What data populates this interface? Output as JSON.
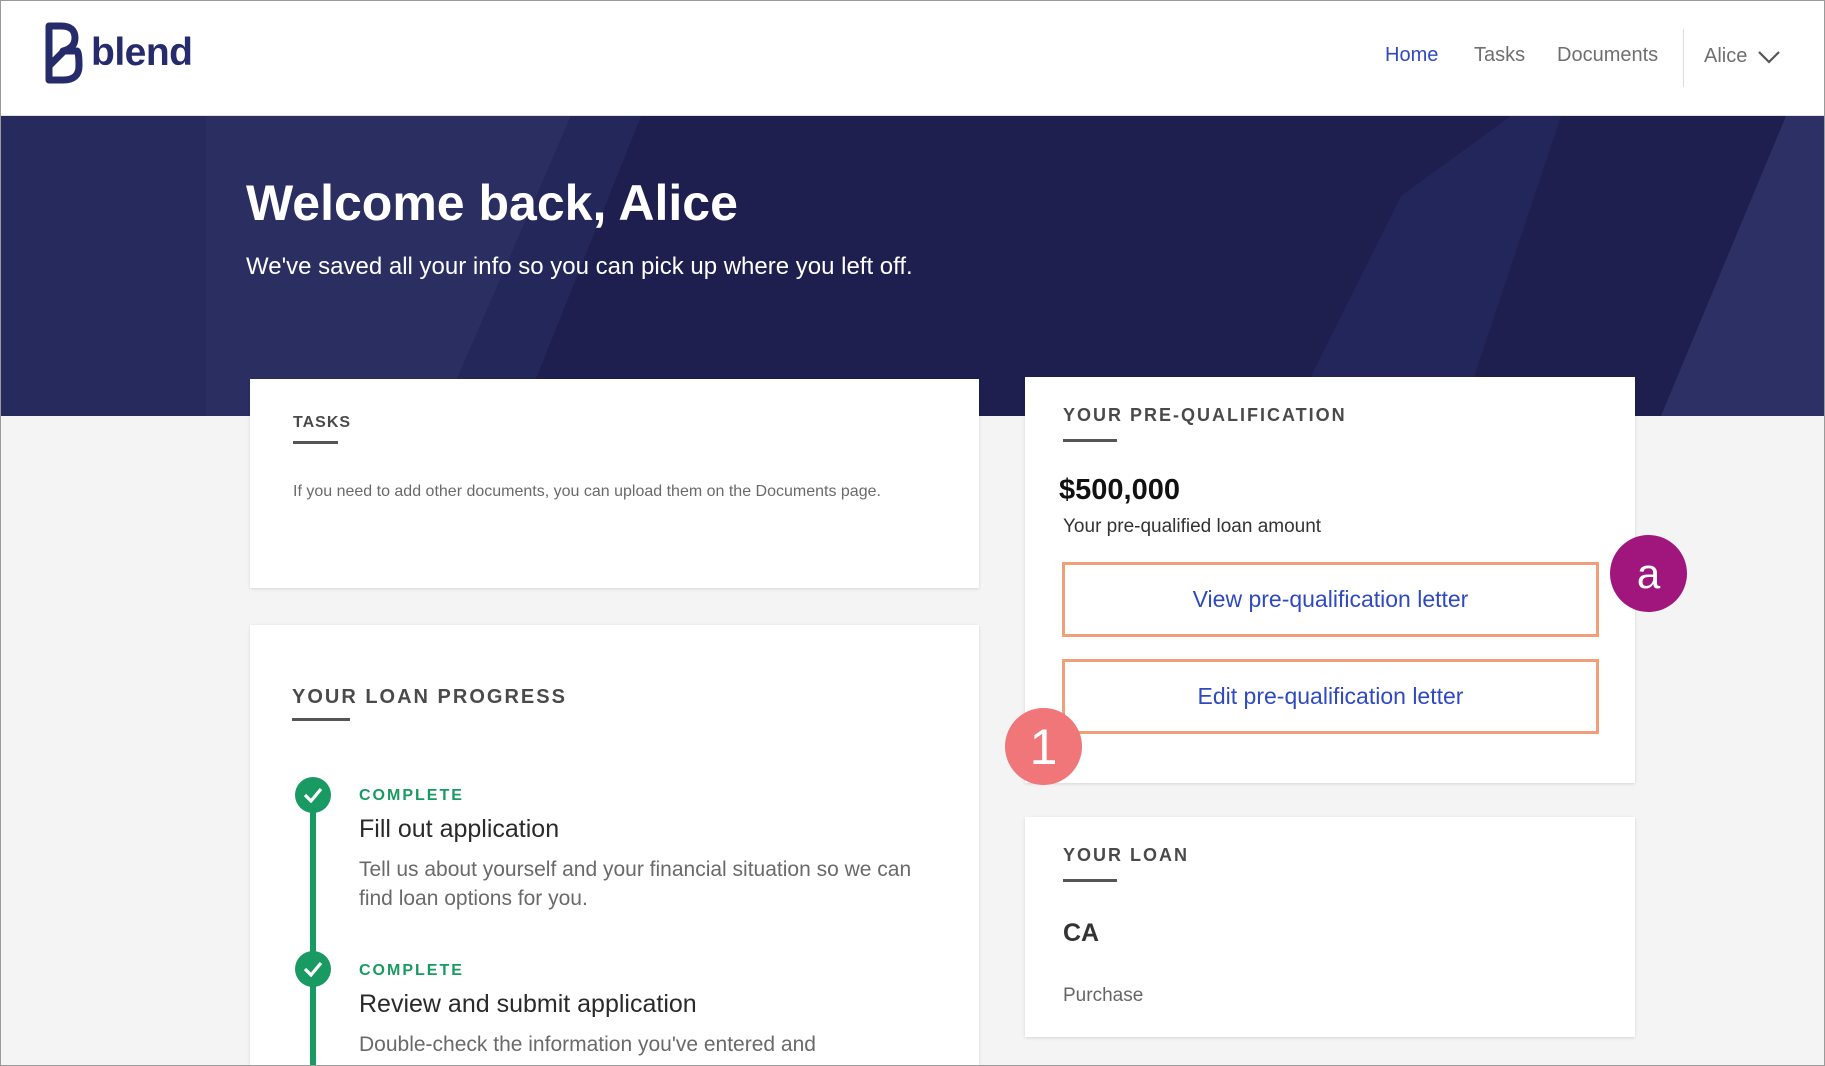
{
  "header": {
    "logo_text": "blend",
    "nav": [
      {
        "label": "Home",
        "active": true
      },
      {
        "label": "Tasks",
        "active": false
      },
      {
        "label": "Documents",
        "active": false
      }
    ],
    "user_name": "Alice"
  },
  "hero": {
    "title": "Welcome back, Alice",
    "subtitle": "We've saved all your info so you can pick up where you left off."
  },
  "tasks_card": {
    "title": "TASKS",
    "note": "If you need to add other documents, you can upload them on the Documents page."
  },
  "progress_card": {
    "title": "YOUR LOAN PROGRESS",
    "steps": [
      {
        "status": "COMPLETE",
        "title": "Fill out application",
        "description": "Tell us about yourself and your financial situation so we can find loan options for you."
      },
      {
        "status": "COMPLETE",
        "title": "Review and submit application",
        "description": "Double-check the information you've entered and"
      }
    ]
  },
  "prequal_card": {
    "title": "YOUR PRE-QUALIFICATION",
    "amount": "$500,000",
    "amount_label": "Your pre-qualified loan amount",
    "view_button": "View pre-qualification letter",
    "edit_button": "Edit pre-qualification letter"
  },
  "loan_card": {
    "title": "YOUR LOAN",
    "state": "CA",
    "type": "Purchase"
  },
  "annotations": {
    "marker_a": "a",
    "marker_1": "1"
  },
  "colors": {
    "brand_navy": "#1e1f4f",
    "link_blue": "#2f4ac1",
    "success_green": "#1a9a63",
    "highlight_outline": "#ef9f79",
    "marker_purple": "#a1167d",
    "marker_coral": "#f07679"
  }
}
